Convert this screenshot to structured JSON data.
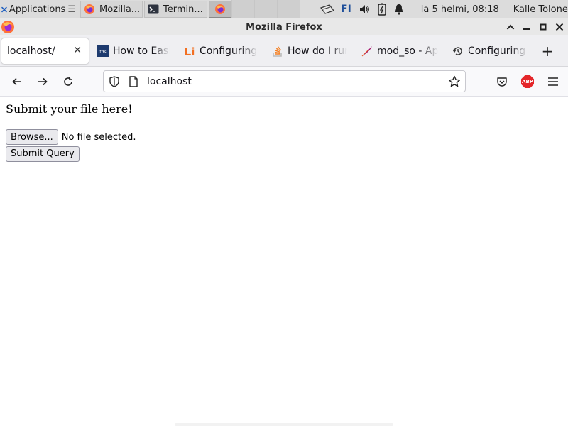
{
  "panel": {
    "applications_label": "Applications",
    "tasks": [
      {
        "label": "Mozilla...",
        "icon": "firefox-icon"
      },
      {
        "label": "Termin...",
        "icon": "terminal-icon"
      },
      {
        "label": "",
        "icon": "firefox-icon"
      }
    ],
    "keyboard_layout": "FI",
    "clock": "la  5 helmi, 08:18",
    "user": "Kalle Tolonen"
  },
  "window": {
    "title": "Mozilla Firefox"
  },
  "tabs": [
    {
      "label": "localhost/",
      "icon": "",
      "active": true
    },
    {
      "label": "How to Easily",
      "icon": "tds-icon"
    },
    {
      "label": "Configuring Ap",
      "icon": "li-icon"
    },
    {
      "label": "How do I run",
      "icon": "stackoverflow-icon"
    },
    {
      "label": "mod_so - Apac",
      "icon": "apache-feather-icon"
    },
    {
      "label": "Configuring A",
      "icon": "history-icon"
    }
  ],
  "navbar": {
    "url": "localhost",
    "abp_label": "ABP"
  },
  "page": {
    "link_text": "Submit your file here!",
    "browse_label": "Browse...",
    "no_file_text": "No file selected.",
    "submit_label": "Submit Query"
  },
  "colors": {
    "abp_red": "#e4262a",
    "tds_blue": "#1d3a6e",
    "li_orange": "#f26f22",
    "apache_purple": "#a4126c",
    "firefox_orange": "#ff7139"
  }
}
